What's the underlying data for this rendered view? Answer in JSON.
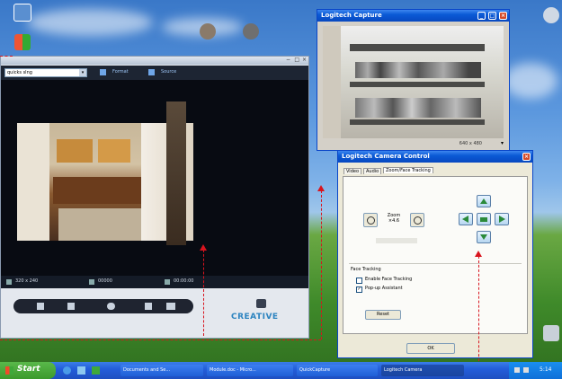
{
  "desktop": {
    "icons": [
      {
        "label": ""
      },
      {
        "label": ""
      },
      {
        "label": ""
      },
      {
        "label": ""
      }
    ]
  },
  "video_window": {
    "dropdown_value": "quicks slng",
    "toolbar": {
      "format_label": "Format",
      "source_label": "Source"
    },
    "status": {
      "resolution": "320 x 240",
      "counter": "00000",
      "time": "00:00:00"
    },
    "brand": "CREATIVE"
  },
  "capture_window": {
    "title": "Logitech Capture",
    "status_text": "640 x 480"
  },
  "camera_control": {
    "title": "Logitech Camera Control",
    "tabs": [
      {
        "label": "Video"
      },
      {
        "label": "Audio"
      },
      {
        "label": "Zoom/Face Tracking"
      }
    ],
    "zoom_label": "Zoom ×4.6",
    "face_tracking_title": "Face Tracking",
    "enable_face_tracking": "Enable Face Tracking",
    "popup_assistant": "Pop-up Assistant",
    "reset_button": "Reset",
    "ok_button": "OK"
  },
  "taskbar": {
    "start_label": "Start",
    "items": [
      {
        "label": "Documents and Se..."
      },
      {
        "label": "Module.doc - Micro..."
      },
      {
        "label": "QuickCapture"
      },
      {
        "label": "Logitech Camera"
      }
    ],
    "clock": "5:14"
  },
  "colors": {
    "annotation": "#d8141e",
    "taskbar": "#245edb",
    "start": "#3c9a2c"
  }
}
